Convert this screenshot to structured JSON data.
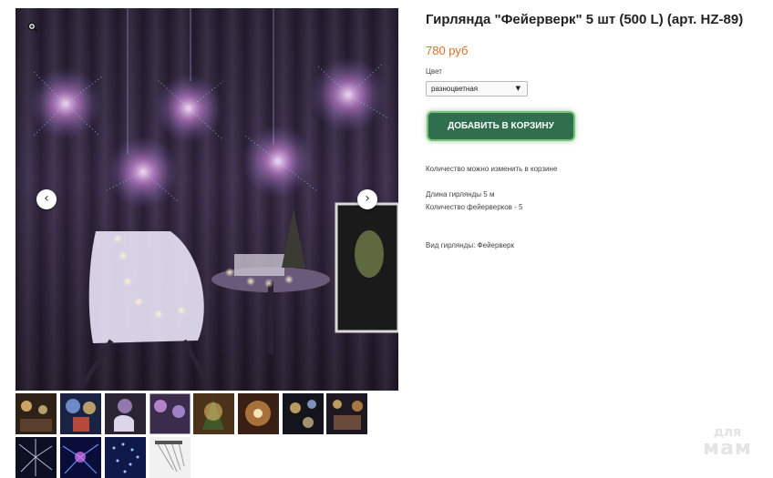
{
  "product": {
    "title": "Гирлянда \"Фейерверк\" 5 шт (500 L) (арт. HZ-89)",
    "price": "780 руб",
    "color_label": "Цвет",
    "color_selected": "разноцветная",
    "add_to_cart_label": "ДОБАВИТЬ В КОРЗИНУ",
    "cart_note": "Количество можно изменить в корзине",
    "specs": [
      "Длина гирлянды 5 м",
      "Количество фейерверков - 5"
    ],
    "type": "Вид гирлянды: Фейерверк"
  },
  "gallery": {
    "prev_icon": "chevron-left-icon",
    "next_icon": "chevron-right-icon",
    "zoom_icon": "zoom-in-icon",
    "thumbnail_count": 12
  },
  "watermark": {
    "line1": "для",
    "line2": "мам"
  },
  "colors": {
    "price": "#e86b2a",
    "button": "#2f6f4d",
    "button_glow": "#7ac27a"
  }
}
